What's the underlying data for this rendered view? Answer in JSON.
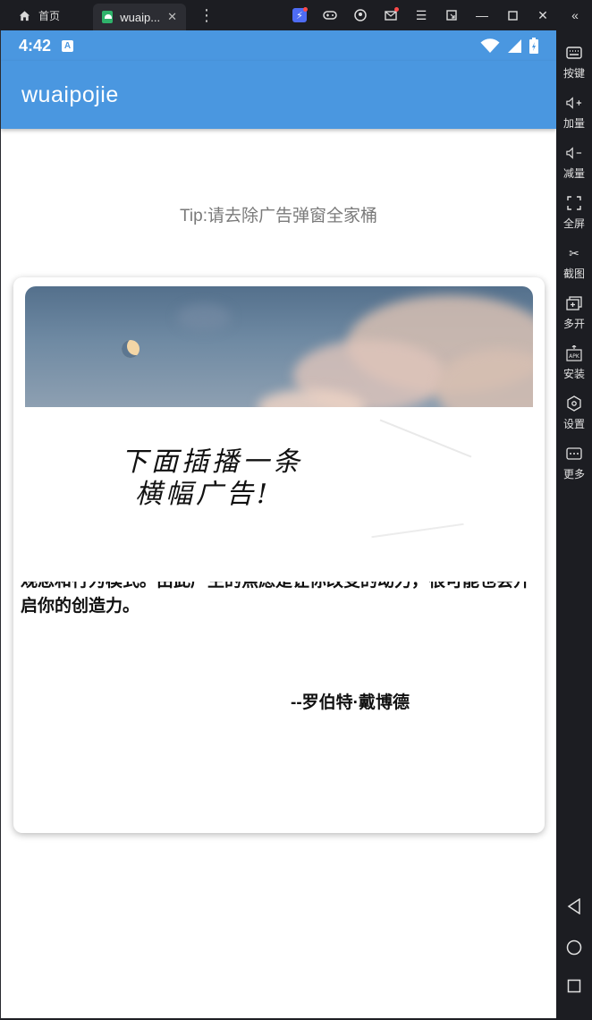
{
  "window": {
    "home_tab_label": "首页",
    "active_tab_label": "wuaip...",
    "close_glyph": "✕",
    "toolbar_icons": [
      "bolt-icon",
      "gamepad-icon",
      "user-icon",
      "mail-icon",
      "menu-icon",
      "restore-icon",
      "minimize-icon",
      "maximize-icon",
      "close-icon",
      "collapse-icon"
    ]
  },
  "sidebar": {
    "items": [
      {
        "label": "按键",
        "icon": "keyboard-icon"
      },
      {
        "label": "加量",
        "icon": "volume-up-icon"
      },
      {
        "label": "减量",
        "icon": "volume-down-icon"
      },
      {
        "label": "全屏",
        "icon": "fullscreen-icon"
      },
      {
        "label": "截图",
        "icon": "scissors-icon"
      },
      {
        "label": "多开",
        "icon": "multi-instance-icon"
      },
      {
        "label": "安装",
        "icon": "apk-install-icon"
      },
      {
        "label": "设置",
        "icon": "settings-icon"
      },
      {
        "label": "更多",
        "icon": "more-icon"
      }
    ],
    "nav": [
      "back-icon",
      "home-icon",
      "recents-icon"
    ]
  },
  "status_bar": {
    "time": "4:42",
    "badge": "A"
  },
  "app_bar": {
    "title": "wuaipojie"
  },
  "content": {
    "tip": "Tip:请去除广告弹窗全家桶",
    "banner_line1": "下面插播一条",
    "banner_line2": "横幅广告!",
    "body_clipped": "观念和行为模式。由此产生的焦虑是让你改变的动力，很可能也会开",
    "body_line2": "启你的创造力。",
    "author": "--罗伯特·戴博德"
  },
  "colors": {
    "accent": "#4a97e0",
    "chrome": "#1c1d22"
  }
}
